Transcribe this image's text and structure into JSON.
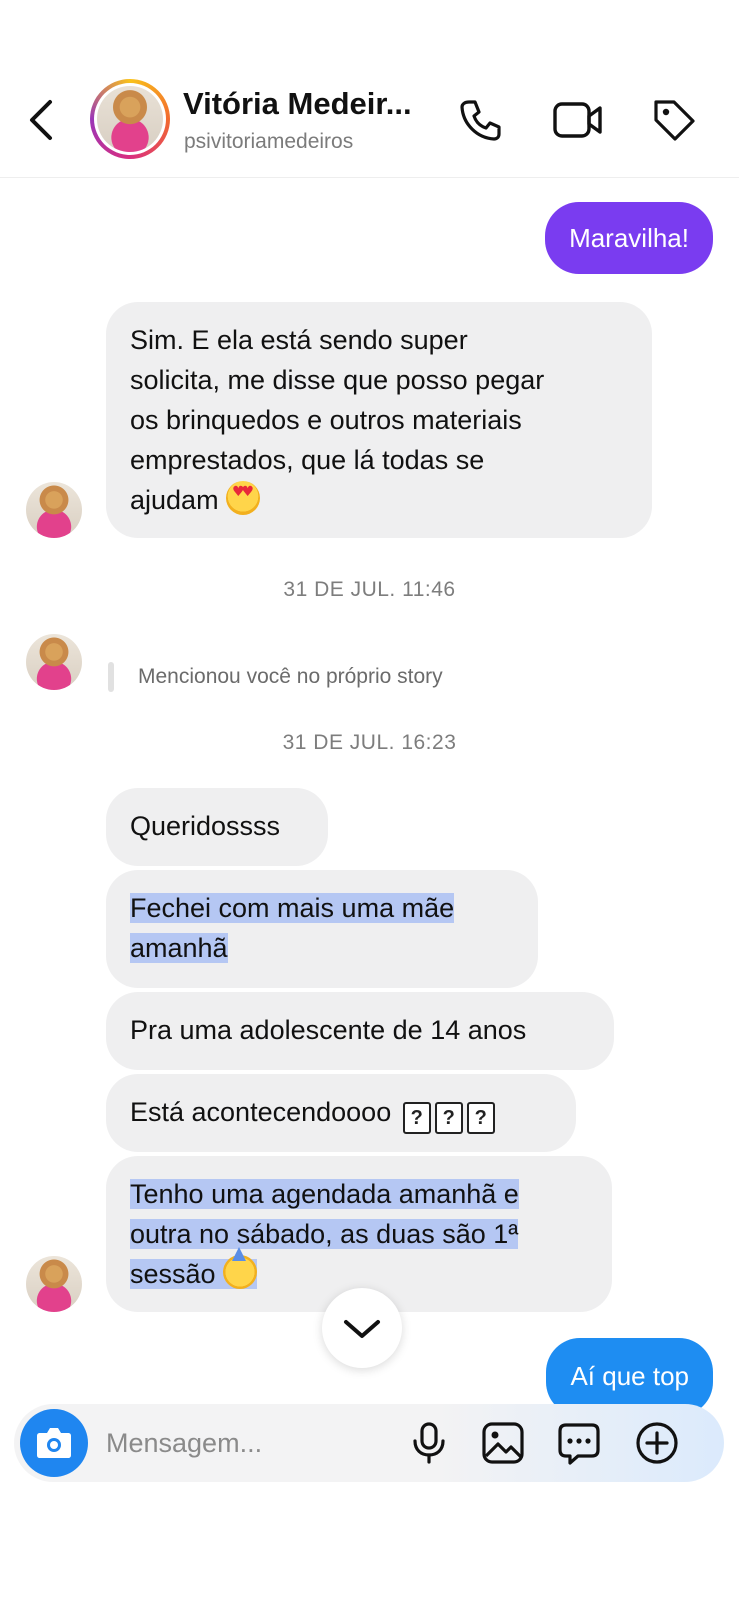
{
  "header": {
    "name": "Vitória Medeir...",
    "username": "psivitoriamedeiros"
  },
  "messages": {
    "out_1": "Maravilha!",
    "in_1_line1": "Sim. E ela está sendo super",
    "in_1_line2": "solicita, me disse que posso pegar",
    "in_1_line3": "os brinquedos e outros materiais",
    "in_1_line4": "emprestados, que lá todas se",
    "in_1_line5": "ajudam",
    "timestamp_1": "31 DE JUL. 11:46",
    "story_mention": "Mencionou você no próprio story",
    "timestamp_2": "31 DE JUL. 16:23",
    "in_2": "Queridossss",
    "in_3_line1": "Fechei com mais uma mãe",
    "in_3_line2": "amanhã",
    "in_4": "Pra uma adolescente de 14 anos",
    "in_5": "Está acontecendoooo",
    "in_5_glyph": "?",
    "in_6_line1": "Tenho uma agendada amanhã e",
    "in_6_line2": "outra no sábado, as duas são 1ª",
    "in_6_line3": "sessão",
    "out_2": "Aí que top"
  },
  "composer": {
    "placeholder": "Mensagem..."
  },
  "colors": {
    "out_1_bubble": "#7a3cf0",
    "out_2_bubble": "#1e8df2",
    "highlight": "#b5c7f3",
    "in_bubble": "#efeff0"
  },
  "icons": [
    "back-arrow-icon",
    "phone-icon",
    "video-camera-icon",
    "tag-icon",
    "chevron-down-icon",
    "camera-icon",
    "microphone-icon",
    "image-icon",
    "sticker-chat-icon",
    "plus-circle-icon"
  ]
}
